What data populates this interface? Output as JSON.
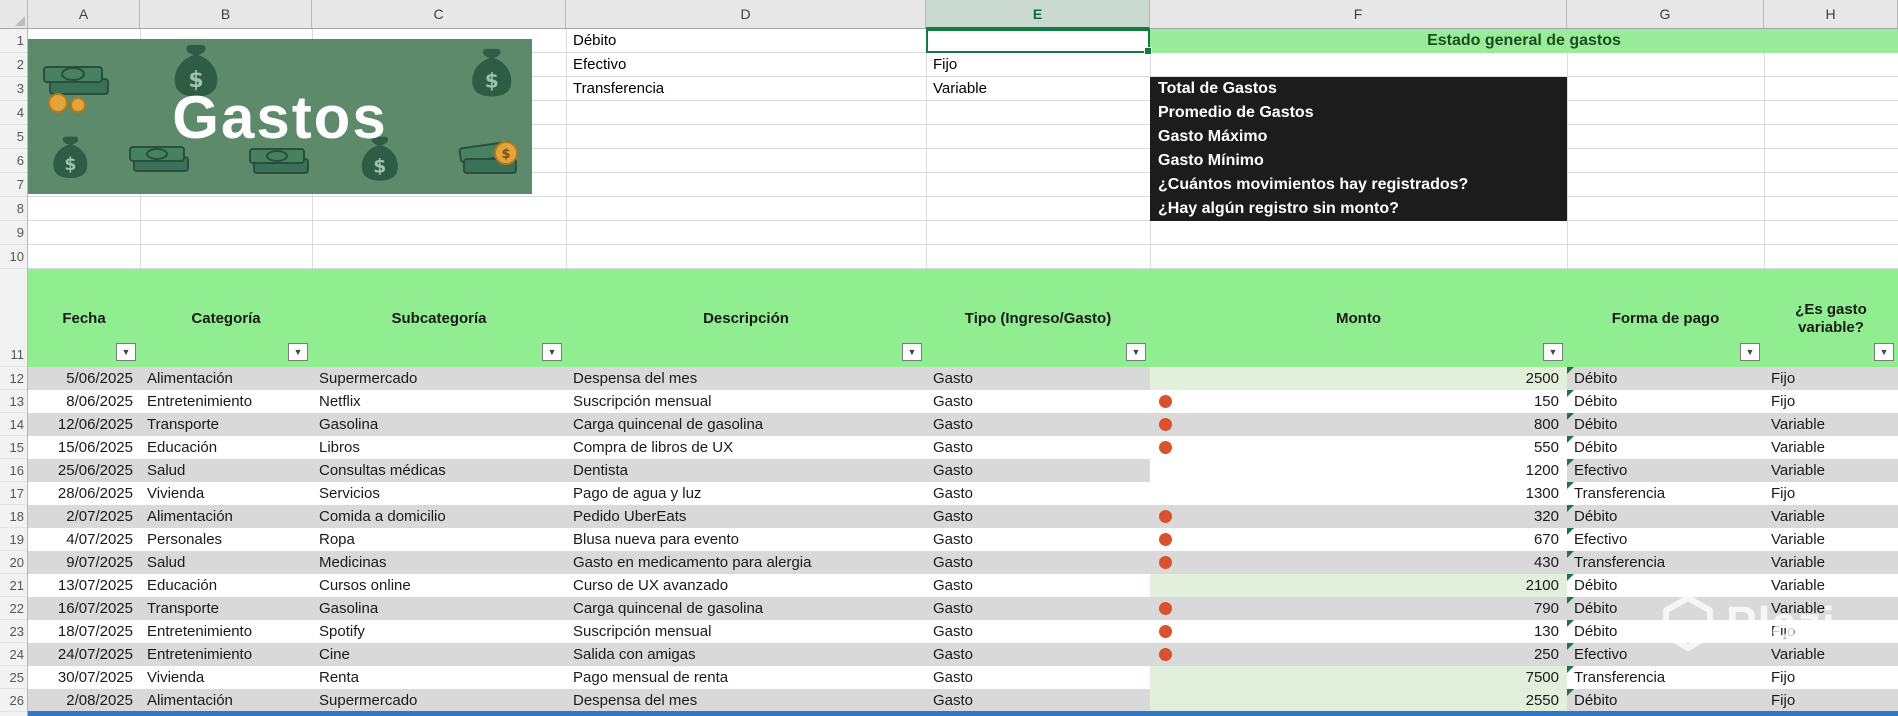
{
  "selection": {
    "column": "E",
    "row": 1
  },
  "column_letters": [
    "A",
    "B",
    "C",
    "D",
    "E",
    "F",
    "G",
    "H"
  ],
  "row_numbers": [
    1,
    2,
    3,
    4,
    5,
    6,
    7,
    8,
    9,
    10,
    11,
    12,
    13,
    14,
    15,
    16,
    17,
    18,
    19,
    20,
    21,
    22,
    23,
    24,
    25,
    26
  ],
  "banner": {
    "title": "Gastos"
  },
  "payment_method_list": [
    "Débito",
    "Efectivo",
    "Transferencia"
  ],
  "expense_type_list": [
    "Fijo",
    "Variable"
  ],
  "summary": {
    "title": "Estado general de gastos",
    "lines": [
      "Total de Gastos",
      "Promedio de Gastos",
      "Gasto Máximo",
      "Gasto Mínimo",
      "¿Cuántos movimientos hay registrados?",
      "¿Hay algún registro sin monto?"
    ]
  },
  "table": {
    "headers": [
      {
        "col": "A",
        "label": "Fecha"
      },
      {
        "col": "B",
        "label": "Categoría"
      },
      {
        "col": "C",
        "label": "Subcategoría"
      },
      {
        "col": "D",
        "label": "Descripción"
      },
      {
        "col": "E",
        "label": "Tipo (Ingreso/Gasto)"
      },
      {
        "col": "F",
        "label": "Monto"
      },
      {
        "col": "G",
        "label": "Forma de pago"
      },
      {
        "col": "H",
        "label": "¿Es gasto variable?"
      }
    ],
    "rows": [
      {
        "fecha": "5/06/2025",
        "categoria": "Alimentación",
        "subcategoria": "Supermercado",
        "descripcion": "Despensa del mes",
        "tipo": "Gasto",
        "monto": "2500",
        "forma_pago": "Débito",
        "es_variable": "Fijo",
        "monto_icon": false,
        "monto_fill": "green"
      },
      {
        "fecha": "8/06/2025",
        "categoria": "Entretenimiento",
        "subcategoria": "Netflix",
        "descripcion": "Suscripción mensual",
        "tipo": "Gasto",
        "monto": "150",
        "forma_pago": "Débito",
        "es_variable": "Fijo",
        "monto_icon": true,
        "monto_fill": "band"
      },
      {
        "fecha": "12/06/2025",
        "categoria": "Transporte",
        "subcategoria": "Gasolina",
        "descripcion": "Carga quincenal de gasolina",
        "tipo": "Gasto",
        "monto": "800",
        "forma_pago": "Débito",
        "es_variable": "Variable",
        "monto_icon": true,
        "monto_fill": "band"
      },
      {
        "fecha": "15/06/2025",
        "categoria": "Educación",
        "subcategoria": "Libros",
        "descripcion": "Compra de libros de UX",
        "tipo": "Gasto",
        "monto": "550",
        "forma_pago": "Débito",
        "es_variable": "Variable",
        "monto_icon": true,
        "monto_fill": "band"
      },
      {
        "fecha": "25/06/2025",
        "categoria": "Salud",
        "subcategoria": "Consultas médicas",
        "descripcion": "Dentista",
        "tipo": "Gasto",
        "monto": "1200",
        "forma_pago": "Efectivo",
        "es_variable": "Variable",
        "monto_icon": false,
        "monto_fill": "white"
      },
      {
        "fecha": "28/06/2025",
        "categoria": "Vivienda",
        "subcategoria": "Servicios",
        "descripcion": "Pago de agua y luz",
        "tipo": "Gasto",
        "monto": "1300",
        "forma_pago": "Transferencia",
        "es_variable": "Fijo",
        "monto_icon": false,
        "monto_fill": "white"
      },
      {
        "fecha": "2/07/2025",
        "categoria": "Alimentación",
        "subcategoria": "Comida a domicilio",
        "descripcion": "Pedido UberEats",
        "tipo": "Gasto",
        "monto": "320",
        "forma_pago": "Débito",
        "es_variable": "Variable",
        "monto_icon": true,
        "monto_fill": "band"
      },
      {
        "fecha": "4/07/2025",
        "categoria": "Personales",
        "subcategoria": "Ropa",
        "descripcion": "Blusa nueva para evento",
        "tipo": "Gasto",
        "monto": "670",
        "forma_pago": "Efectivo",
        "es_variable": "Variable",
        "monto_icon": true,
        "monto_fill": "band"
      },
      {
        "fecha": "9/07/2025",
        "categoria": "Salud",
        "subcategoria": "Medicinas",
        "descripcion": "Gasto en medicamento para alergia",
        "tipo": "Gasto",
        "monto": "430",
        "forma_pago": "Transferencia",
        "es_variable": "Variable",
        "monto_icon": true,
        "monto_fill": "band"
      },
      {
        "fecha": "13/07/2025",
        "categoria": "Educación",
        "subcategoria": "Cursos online",
        "descripcion": "Curso de UX avanzado",
        "tipo": "Gasto",
        "monto": "2100",
        "forma_pago": "Débito",
        "es_variable": "Variable",
        "monto_icon": false,
        "monto_fill": "green"
      },
      {
        "fecha": "16/07/2025",
        "categoria": "Transporte",
        "subcategoria": "Gasolina",
        "descripcion": "Carga quincenal de gasolina",
        "tipo": "Gasto",
        "monto": "790",
        "forma_pago": "Débito",
        "es_variable": "Variable",
        "monto_icon": true,
        "monto_fill": "band"
      },
      {
        "fecha": "18/07/2025",
        "categoria": "Entretenimiento",
        "subcategoria": "Spotify",
        "descripcion": "Suscripción mensual",
        "tipo": "Gasto",
        "monto": "130",
        "forma_pago": "Débito",
        "es_variable": "Fijo",
        "monto_icon": true,
        "monto_fill": "band"
      },
      {
        "fecha": "24/07/2025",
        "categoria": "Entretenimiento",
        "subcategoria": "Cine",
        "descripcion": "Salida con amigas",
        "tipo": "Gasto",
        "monto": "250",
        "forma_pago": "Efectivo",
        "es_variable": "Variable",
        "monto_icon": true,
        "monto_fill": "band"
      },
      {
        "fecha": "30/07/2025",
        "categoria": "Vivienda",
        "subcategoria": "Renta",
        "descripcion": "Pago mensual de renta",
        "tipo": "Gasto",
        "monto": "7500",
        "forma_pago": "Transferencia",
        "es_variable": "Fijo",
        "monto_icon": false,
        "monto_fill": "green"
      },
      {
        "fecha": "2/08/2025",
        "categoria": "Alimentación",
        "subcategoria": "Supermercado",
        "descripcion": "Despensa del mes",
        "tipo": "Gasto",
        "monto": "2550",
        "forma_pago": "Débito",
        "es_variable": "Fijo",
        "monto_icon": false,
        "monto_fill": "green"
      }
    ]
  },
  "watermark": {
    "text": "Plazi"
  },
  "colors": {
    "header_green": "#90EE90",
    "estado_green": "#9AEB9A",
    "banner_green": "#5C8A6B",
    "band_gray": "#D9D9D9",
    "monto_highlight_green": "#E2EFDA",
    "low_value_dot_red": "#D9512F",
    "selection_green": "#107C41",
    "summary_box_dark": "#1C1C1C",
    "bottom_row_blue": "#2E78C8"
  }
}
